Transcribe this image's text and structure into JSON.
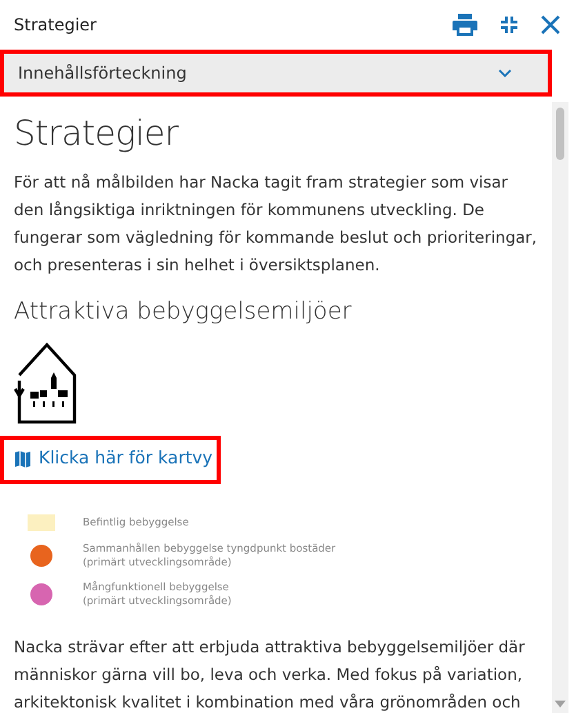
{
  "panel": {
    "title": "Strategier"
  },
  "toc": {
    "label": "Innehållsförteckning",
    "expanded": false
  },
  "heading": "Strategier",
  "intro": "För att nå målbilden har Nacka tagit fram strategier som visar den långsiktiga inriktningen för kommunens utveckling. De fungerar som vägledning för kommande beslut och prioriteringar, och presenteras i sin helhet i översiktsplanen.",
  "section": {
    "heading": "Attraktiva bebyggelsemiljöer",
    "map_link": "Klicka här för kartvy",
    "legend": [
      {
        "kind": "area",
        "color": "#fcf0c0",
        "lines": [
          "Befintlig bebyggelse"
        ]
      },
      {
        "kind": "dot",
        "color": "#e8641e",
        "lines": [
          "Sammanhållen bebyggelse tyngdpunkt bostäder",
          "(primärt utvecklingsområde)"
        ]
      },
      {
        "kind": "dot",
        "color": "#d765b0",
        "lines": [
          "Mångfunktionell bebyggelse",
          "(primärt utvecklingsområde)"
        ]
      }
    ],
    "body": "Nacka strävar efter att erbjuda attraktiva bebyggelsemiljöer där människor gärna vill bo, leva och verka. Med fokus på variation, arkitektonisk kvalitet i kombination med våra grönområden och"
  }
}
